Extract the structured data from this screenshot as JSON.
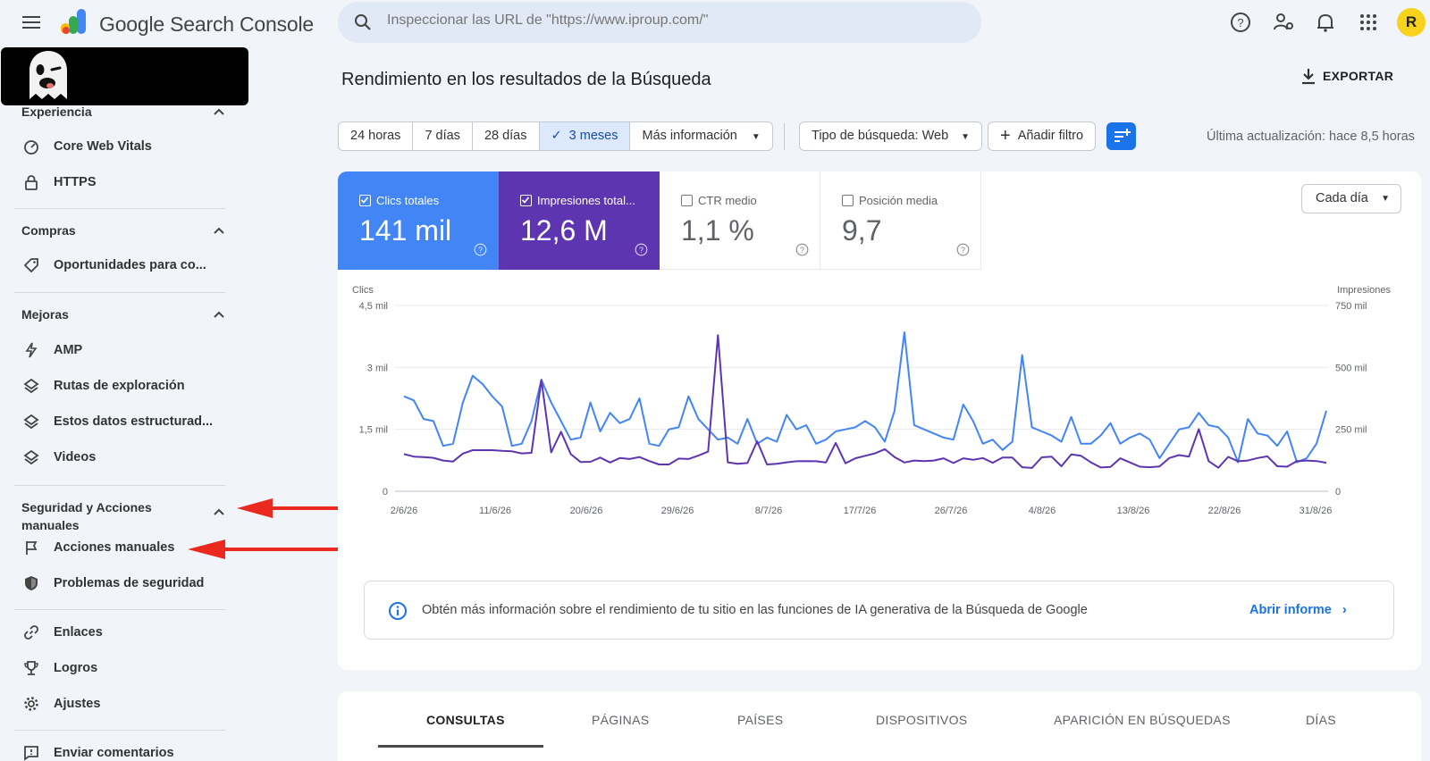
{
  "header": {
    "brand": "Google Search Console",
    "search_placeholder": "Inspeccionar las URL de \"https://www.iproup.com/\"",
    "avatar_letter": "R"
  },
  "sidebar": {
    "sections": [
      {
        "title": "Experiencia",
        "items": [
          {
            "label": "Core Web Vitals",
            "icon": "gauge-icon"
          },
          {
            "label": "HTTPS",
            "icon": "lock-icon"
          }
        ]
      },
      {
        "title": "Compras",
        "items": [
          {
            "label": "Oportunidades para co...",
            "icon": "tag-icon"
          }
        ]
      },
      {
        "title": "Mejoras",
        "items": [
          {
            "label": "AMP",
            "icon": "bolt-icon"
          },
          {
            "label": "Rutas de exploración",
            "icon": "layers-icon"
          },
          {
            "label": "Estos datos estructurad...",
            "icon": "layers-icon"
          },
          {
            "label": "Videos",
            "icon": "layers-icon"
          }
        ]
      },
      {
        "title_line1": "Seguridad y Acciones",
        "title_line2": "manuales",
        "items": [
          {
            "label": "Acciones manuales",
            "icon": "flag-icon"
          },
          {
            "label": "Problemas de seguridad",
            "icon": "shield-icon"
          }
        ]
      }
    ],
    "bottom": [
      {
        "label": "Enlaces",
        "icon": "link-icon"
      },
      {
        "label": "Logros",
        "icon": "trophy-icon"
      },
      {
        "label": "Ajustes",
        "icon": "gear-icon"
      },
      {
        "label": "Enviar comentarios",
        "icon": "feedback-icon"
      }
    ]
  },
  "page": {
    "title": "Rendimiento en los resultados de la Búsqueda",
    "export_label": "EXPORTAR",
    "ranges": [
      "24 horas",
      "7 días",
      "28 días",
      "3 meses",
      "Más información"
    ],
    "selected_range": "3 meses",
    "search_type": "Tipo de búsqueda: Web",
    "add_filter": "Añadir filtro",
    "last_update": "Última actualización: hace 8,5 horas"
  },
  "metrics": [
    {
      "label": "Clics totales",
      "value": "141 mil",
      "checked": true,
      "color": "#4285f4"
    },
    {
      "label": "Impresiones total...",
      "value": "12,6 M",
      "checked": true,
      "color": "#5e35b1"
    },
    {
      "label": "CTR medio",
      "value": "1,1 %",
      "checked": false
    },
    {
      "label": "Posición media",
      "value": "9,7",
      "checked": false
    }
  ],
  "granularity": "Cada día",
  "chart_data": {
    "type": "line",
    "left_axis_label": "Clics",
    "right_axis_label": "Impresiones",
    "left_ticks": [
      "4,5 mil",
      "3 mil",
      "1,5 mil",
      "0"
    ],
    "right_ticks": [
      "750 mil",
      "500 mil",
      "250 mil",
      "0"
    ],
    "ylim_left": [
      0,
      4500
    ],
    "ylim_right": [
      0,
      750000
    ],
    "x_labels": [
      "2/6/26",
      "11/6/26",
      "20/6/26",
      "29/6/26",
      "8/7/26",
      "17/7/26",
      "26/7/26",
      "4/8/26",
      "13/8/26",
      "22/8/26",
      "31/8/26"
    ],
    "series": [
      {
        "name": "Clics",
        "axis": "left",
        "color": "#4285f4",
        "values": [
          2300,
          2200,
          1750,
          1700,
          1100,
          1150,
          2150,
          2800,
          2600,
          2300,
          2050,
          1100,
          1150,
          1700,
          2700,
          2150,
          1700,
          1250,
          1300,
          2150,
          1450,
          1900,
          1650,
          1750,
          2250,
          1150,
          1100,
          1500,
          1550,
          2300,
          1750,
          1500,
          1250,
          1300,
          1150,
          1750,
          1150,
          1300,
          1200,
          1850,
          1500,
          1600,
          1150,
          1250,
          1450,
          1500,
          1550,
          1700,
          1550,
          1200,
          1950,
          3850,
          1600,
          1500,
          1400,
          1300,
          1250,
          2100,
          1700,
          1150,
          1250,
          1000,
          1200,
          3300,
          1550,
          1450,
          1350,
          1200,
          1800,
          1150,
          1150,
          1350,
          1650,
          1150,
          1300,
          1400,
          1250,
          800,
          1150,
          1500,
          1550,
          1900,
          1600,
          1550,
          1300,
          700,
          1750,
          1400,
          1350,
          1100,
          1450,
          700,
          800,
          1150,
          1950
        ]
      },
      {
        "name": "Impresiones",
        "axis": "right",
        "color": "#5e35b1",
        "values": [
          150000,
          140000,
          138000,
          135000,
          124000,
          120000,
          152000,
          166000,
          166000,
          166000,
          163000,
          161000,
          153000,
          155000,
          450000,
          157000,
          240000,
          150000,
          118000,
          119000,
          136000,
          116000,
          134000,
          130000,
          138000,
          122000,
          108000,
          108000,
          132000,
          130000,
          144000,
          160000,
          630000,
          117000,
          111000,
          114000,
          202000,
          108000,
          111000,
          117000,
          121000,
          122000,
          121000,
          116000,
          195000,
          113000,
          133000,
          143000,
          153000,
          170000,
          138000,
          116000,
          124000,
          122000,
          124000,
          133000,
          114000,
          133000,
          127000,
          134000,
          115000,
          136000,
          136000,
          97000,
          94000,
          137000,
          140000,
          101000,
          149000,
          143000,
          117000,
          96000,
          98000,
          133000,
          116000,
          99000,
          97000,
          100000,
          134000,
          146000,
          140000,
          251000,
          122000,
          95000,
          139000,
          121000,
          124000,
          134000,
          141000,
          101000,
          99000,
          122000,
          124000,
          122000,
          115000
        ]
      }
    ]
  },
  "info": {
    "text": "Obtén más información sobre el rendimiento de tu sitio en las funciones de IA generativa de la Búsqueda de Google",
    "link": "Abrir informe"
  },
  "tabs": [
    "CONSULTAS",
    "PÁGINAS",
    "PAÍSES",
    "DISPOSITIVOS",
    "APARICIÓN EN BÚSQUEDAS",
    "DÍAS"
  ],
  "colors": {
    "accent": "#1a73e8",
    "clicks": "#4285f4",
    "impressions": "#5e35b1",
    "arrow": "#ea2a1f"
  }
}
